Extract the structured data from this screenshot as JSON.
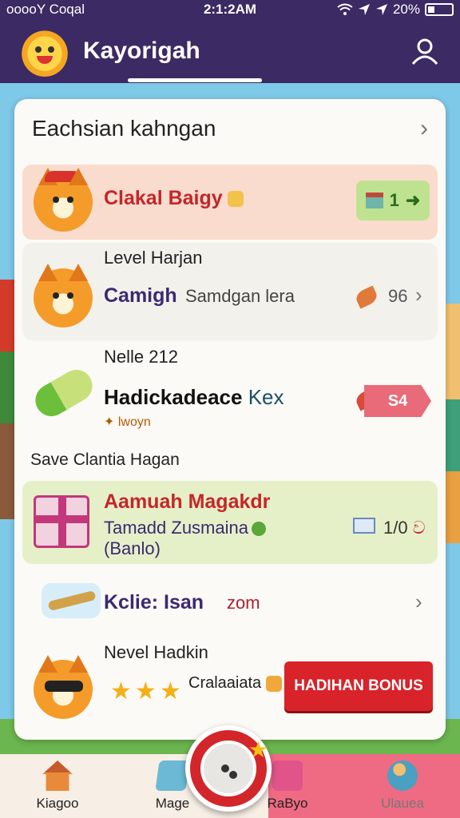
{
  "status_bar": {
    "carrier": "ooooY Coqal",
    "time": "2:1:2AM",
    "battery": "20%"
  },
  "header": {
    "title": "Kayorigah"
  },
  "card": {
    "title": "Eachsian kahngan",
    "rows": [
      {
        "title": "Clakal Baigy",
        "badge_value": "1",
        "badge_arrow": "➜"
      },
      {
        "level": "Level Harjan",
        "title": "Camigh",
        "subtitle": "Samdgan lera",
        "value": "96"
      },
      {
        "level": "Nelle 212",
        "title_main": "Hadickadeace",
        "title_tail": "Kex",
        "note": "lwoyn",
        "tag": "S4"
      }
    ],
    "section_label": "Save Clantia Hagan",
    "featured": {
      "title": "Aamuah Magakdr",
      "subtitle": "Tamadd Zusmaina",
      "paren": "(Banlo)",
      "value": "1/0",
      "suffix": "ව"
    },
    "item": {
      "title": "Kclie: Isan",
      "zoom": "zom"
    },
    "bonus_row": {
      "title": "Nevel Hadkin",
      "stars_text": "Cralaaiata",
      "button": "HADIHAN BONUS"
    }
  },
  "bottom_nav": [
    {
      "label": "Kiagoo",
      "icon": "home-icon"
    },
    {
      "label": "Mage",
      "icon": "map-icon"
    },
    {
      "label": "RaByo",
      "icon": "gift-icon"
    },
    {
      "label": "Ulauea",
      "icon": "people-icon"
    }
  ],
  "colors": {
    "header_bg": "#3b2a63",
    "accent_red": "#d8232a",
    "featured_bg": "#e6f0c8",
    "highlight_bg": "#f9dccd"
  }
}
